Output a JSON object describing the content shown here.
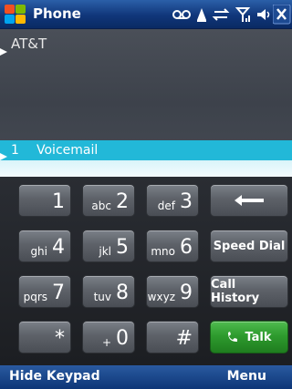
{
  "titlebar": {
    "app_title": "Phone",
    "icons": [
      "windows-start-icon",
      "voicemail-icon",
      "notification-icon",
      "data-connection-icon",
      "signal-icon",
      "speaker-icon",
      "close-icon"
    ]
  },
  "history": {
    "carrier": "AT&T",
    "voicemail_number": "1",
    "voicemail_label": "Voicemail"
  },
  "keypad": {
    "keys": [
      {
        "num": "1",
        "letters": ""
      },
      {
        "num": "2",
        "letters": "abc"
      },
      {
        "num": "3",
        "letters": "def"
      },
      {
        "num": "4",
        "letters": "ghi"
      },
      {
        "num": "5",
        "letters": "jkl"
      },
      {
        "num": "6",
        "letters": "mno"
      },
      {
        "num": "7",
        "letters": "pqrs"
      },
      {
        "num": "8",
        "letters": "tuv"
      },
      {
        "num": "9",
        "letters": "wxyz"
      },
      {
        "num": "*",
        "letters": ""
      },
      {
        "num": "0",
        "letters": "+"
      },
      {
        "num": "#",
        "letters": ""
      }
    ],
    "side": {
      "backspace": "backspace-arrow-icon",
      "speed_dial": "Speed Dial",
      "call_history": "Call History",
      "talk": "Talk"
    }
  },
  "softkeys": {
    "left": "Hide Keypad",
    "right": "Menu"
  },
  "colors": {
    "title_blue": "#10367a",
    "highlight": "#22b8d8",
    "talk_green": "#2e9b2e"
  }
}
